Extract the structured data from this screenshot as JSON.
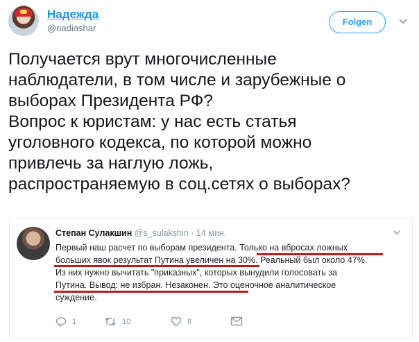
{
  "author": {
    "name": "Надежда",
    "handle": "@nadiashar"
  },
  "follow_label": "Folgen",
  "tweet_lines": [
    "Получается врут  многочисленные",
    "наблюдатели, в том числе и зарубежные о",
    "выборах Президента РФ?",
    "Вопрос к юристам: у нас есть статья",
    "уголовного кодекса, по которой можно",
    "привлечь за наглую ложь,",
    "распространяемую в соц.сетях о выборах?"
  ],
  "embedded": {
    "name": "Степан Сулакшин",
    "handle": "@s_sulakshin",
    "time": "· 14 мин.",
    "lines": [
      "Первый наш расчет по выборам президента. Только на вбросах ложных",
      "больших явок результат Путина увеличен на 30%. Реальный был около 47%.",
      "Из них нужно вычитать \"приказных\", которых вынудили голосовать за",
      "Путина. Вывод: не избран. Незаконен. Это оценочное аналитическое",
      "суждение."
    ],
    "actions": {
      "replies": "1",
      "retweets": "10",
      "likes": "8"
    }
  },
  "colors": {
    "link": "#1b95e0",
    "follow": "#1da1f2",
    "underline": "#c01818",
    "muted": "#8899a6"
  },
  "icons": [
    "avatar",
    "chevron-down-icon",
    "reply-icon",
    "retweet-icon",
    "heart-icon",
    "envelope-icon"
  ]
}
